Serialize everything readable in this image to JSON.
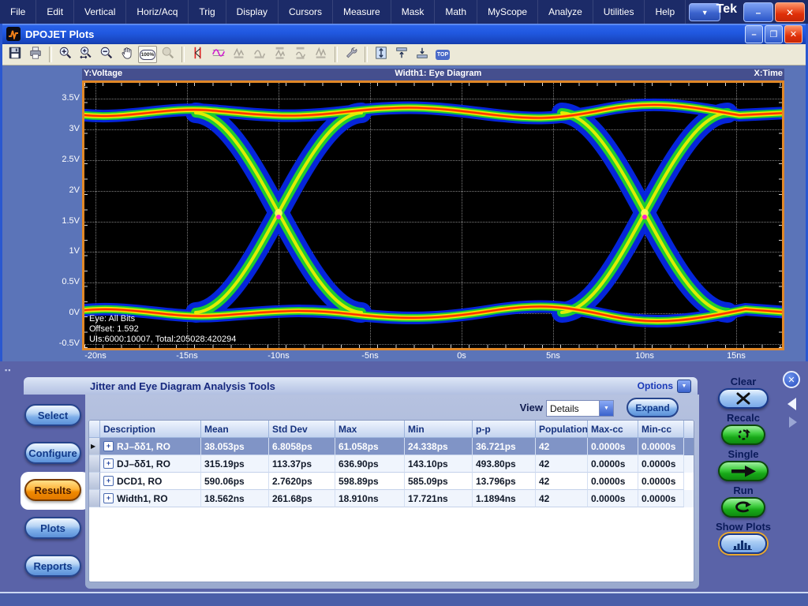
{
  "menu_bar": {
    "items": [
      "File",
      "Edit",
      "Vertical",
      "Horiz/Acq",
      "Trig",
      "Display",
      "Cursors",
      "Measure",
      "Mask",
      "Math",
      "MyScope",
      "Analyze",
      "Utilities",
      "Help"
    ],
    "menu_dropdown_icon": "▼",
    "brand": "Tek",
    "window_controls": {
      "minimize": "–",
      "close": "✕"
    }
  },
  "plots_window": {
    "title": "DPOJET Plots",
    "window_controls": {
      "minimize": "–",
      "maximize": "❐",
      "close": "✕"
    },
    "toolbar": {
      "zoom100_label": "100%",
      "top_label": "TOP",
      "icon_names": [
        "save",
        "print",
        "zoom-in",
        "zoom-horizontal",
        "zoom-out",
        "pan",
        "zoom-100",
        "zoom-sync",
        "vertical-cursors",
        "waveform-cursors",
        "reset-vertical",
        "reset-horizontal",
        "max-min-vertical",
        "max-min-horizontal",
        "sync",
        "wrench",
        "fit-vertical",
        "align-top",
        "align-bottom",
        "top"
      ]
    }
  },
  "plot": {
    "header_left": "Y:Voltage",
    "header_center": "Width1: Eye Diagram",
    "header_right": "X:Time",
    "y_tick_labels": [
      "3.5V",
      "3V",
      "2.5V",
      "2V",
      "1.5V",
      "1V",
      "0.5V",
      "0V",
      "-0.5V"
    ],
    "x_tick_labels": [
      "-20ns",
      "-15ns",
      "-10ns",
      "-5ns",
      "0s",
      "5ns",
      "10ns",
      "15ns"
    ],
    "annotation_lines": [
      "Eye: All Bits",
      "Offset: 1.592",
      "UIs:6000:10007, Total:205028:420294"
    ]
  },
  "panel": {
    "title": "Jitter and Eye Diagram Analysis Tools",
    "options_label": "Options",
    "options_dropdown_icon": "▼",
    "nav": [
      "Select",
      "Configure",
      "Results",
      "Plots",
      "Reports"
    ],
    "active_nav": "Results",
    "view_label": "View",
    "view_value": "Details",
    "view_dropdown_icon": "▼",
    "expand_label": "Expand",
    "close_icon": "✕",
    "table": {
      "columns": [
        "Description",
        "Mean",
        "Std Dev",
        "Max",
        "Min",
        "p-p",
        "Population",
        "Max-cc",
        "Min-cc"
      ],
      "selected_indicator": "▶",
      "expand_icon": "+",
      "rows": [
        {
          "description": "RJ–δδ1, RO",
          "values": [
            "38.053ps",
            "6.8058ps",
            "61.058ps",
            "24.338ps",
            "36.721ps",
            "42",
            "0.0000s",
            "0.0000s"
          ],
          "selected": true
        },
        {
          "description": "DJ–δδ1, RO",
          "values": [
            "315.19ps",
            "113.37ps",
            "636.90ps",
            "143.10ps",
            "493.80ps",
            "42",
            "0.0000s",
            "0.0000s"
          ],
          "selected": false
        },
        {
          "description": "DCD1, RO",
          "values": [
            "590.06ps",
            "2.7620ps",
            "598.89ps",
            "585.09ps",
            "13.796ps",
            "42",
            "0.0000s",
            "0.0000s"
          ],
          "selected": false
        },
        {
          "description": "Width1, RO",
          "values": [
            "18.562ns",
            "261.68ps",
            "18.910ns",
            "17.721ns",
            "1.1894ns",
            "42",
            "0.0000s",
            "0.0000s"
          ],
          "selected": false
        }
      ]
    },
    "actions": {
      "clear": "Clear",
      "recalc": "Recalc",
      "single": "Single",
      "run": "Run",
      "show_plots": "Show Plots"
    }
  },
  "chart_data": {
    "type": "line",
    "subtype": "eye-diagram-persistence",
    "title": "Width1: Eye Diagram",
    "xlabel": "Time",
    "ylabel": "Voltage",
    "x_ticks": [
      "-20ns",
      "-15ns",
      "-10ns",
      "-5ns",
      "0s",
      "5ns",
      "10ns",
      "15ns"
    ],
    "y_ticks": [
      "3.5V",
      "3V",
      "2.5V",
      "2V",
      "1.5V",
      "1V",
      "0.5V",
      "0V",
      "-0.5V"
    ],
    "xlim": [
      "-20.6ns",
      "17.8ns"
    ],
    "ylim": [
      "-0.55V",
      "3.62V"
    ],
    "high_level_V": 3.3,
    "low_level_V": 0.0,
    "crossing_points_ns": [
      -10,
      10
    ],
    "crossing_level_V": 1.6,
    "eye_width_ns": 20,
    "crossing_markers": {
      "color": "#ff22cc",
      "positions_ns": [
        -10,
        10
      ]
    },
    "annotations": [
      "Eye: All Bits",
      "Offset: 1.592",
      "UIs:6000:10007, Total:205028:420294"
    ],
    "persistence_colormap": [
      "#0628e6",
      "#1ecc30",
      "#f4f000",
      "#ff8800",
      "#ff2a00"
    ],
    "background": "#000000",
    "grid": "dotted-white",
    "frame_color": "#e08828",
    "legend": "none"
  }
}
